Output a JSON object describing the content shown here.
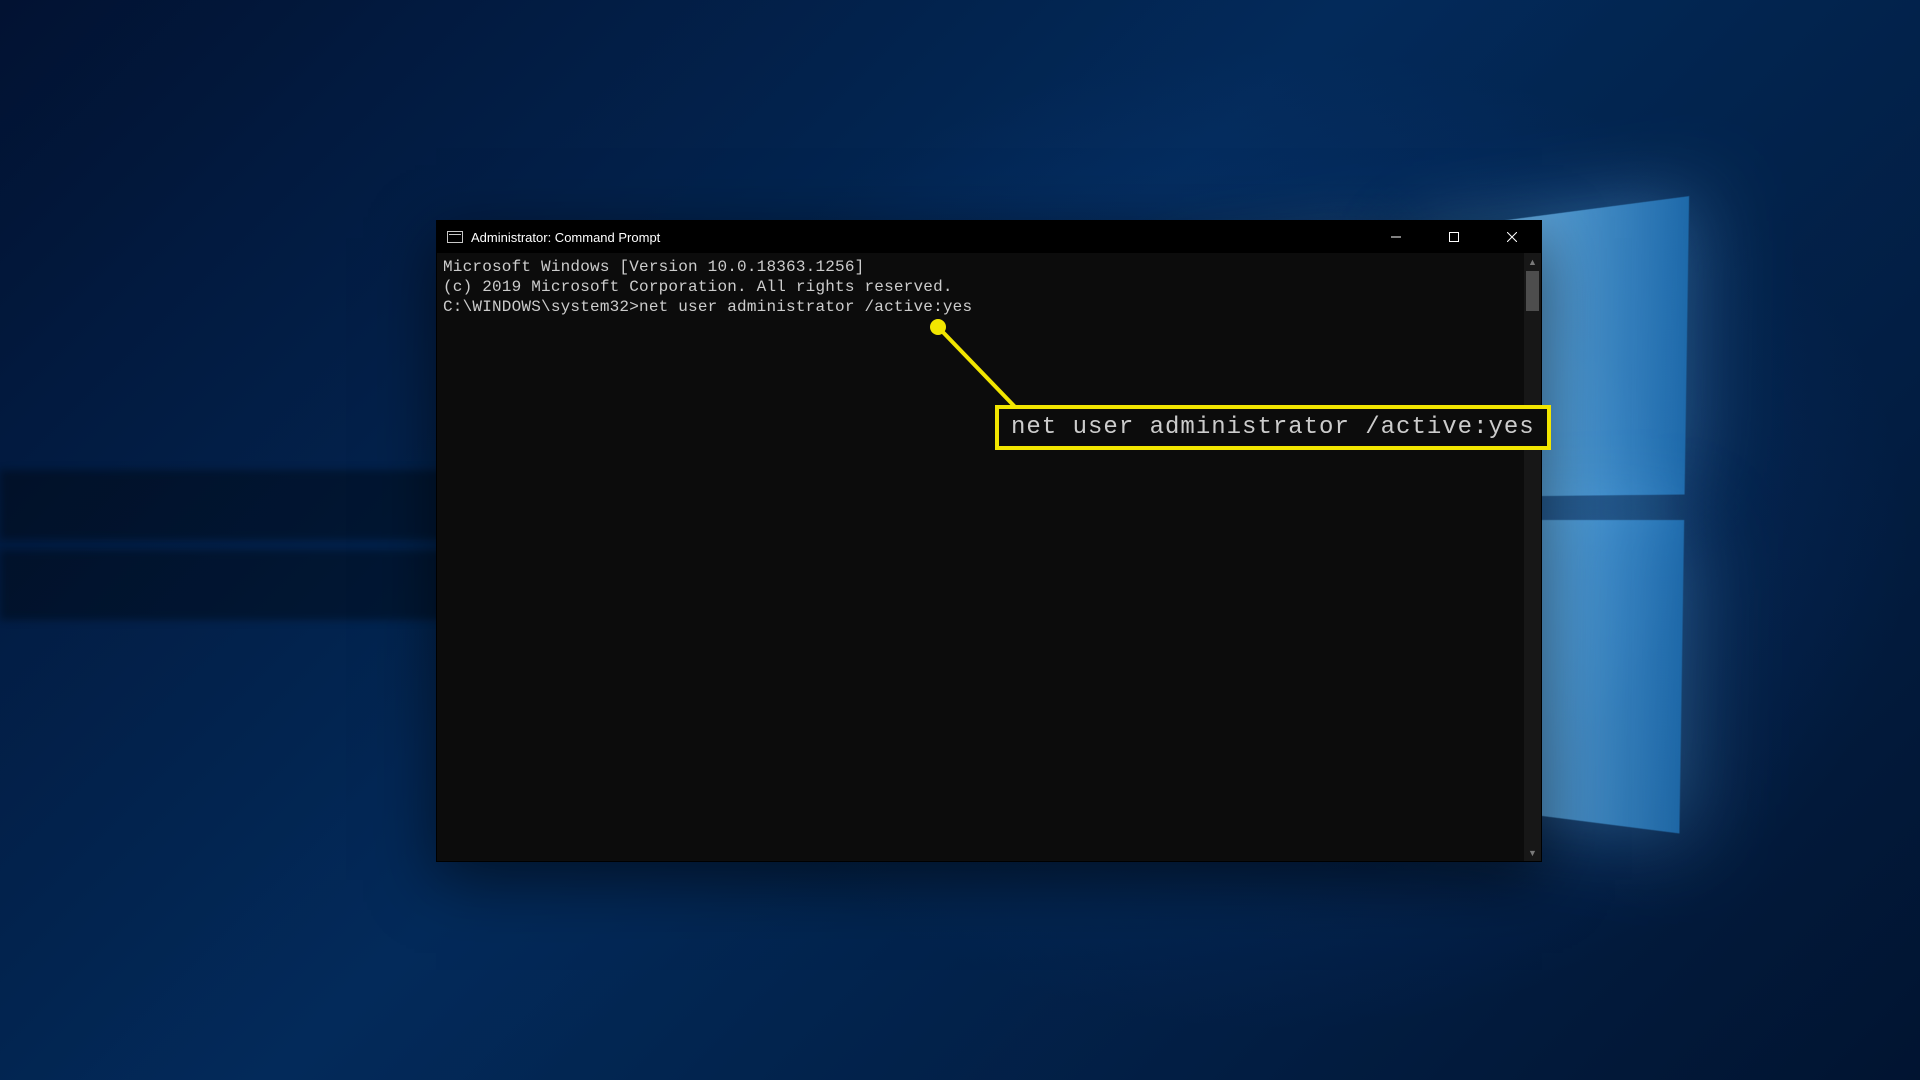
{
  "window": {
    "title": "Administrator: Command Prompt"
  },
  "terminal": {
    "line1": "Microsoft Windows [Version 10.0.18363.1256]",
    "line2": "(c) 2019 Microsoft Corporation. All rights reserved.",
    "blank": "",
    "prompt": "C:\\WINDOWS\\system32>",
    "command": "net user administrator /active:yes"
  },
  "annotation": {
    "callout": "net user administrator /active:yes",
    "color": "#f2e600"
  }
}
